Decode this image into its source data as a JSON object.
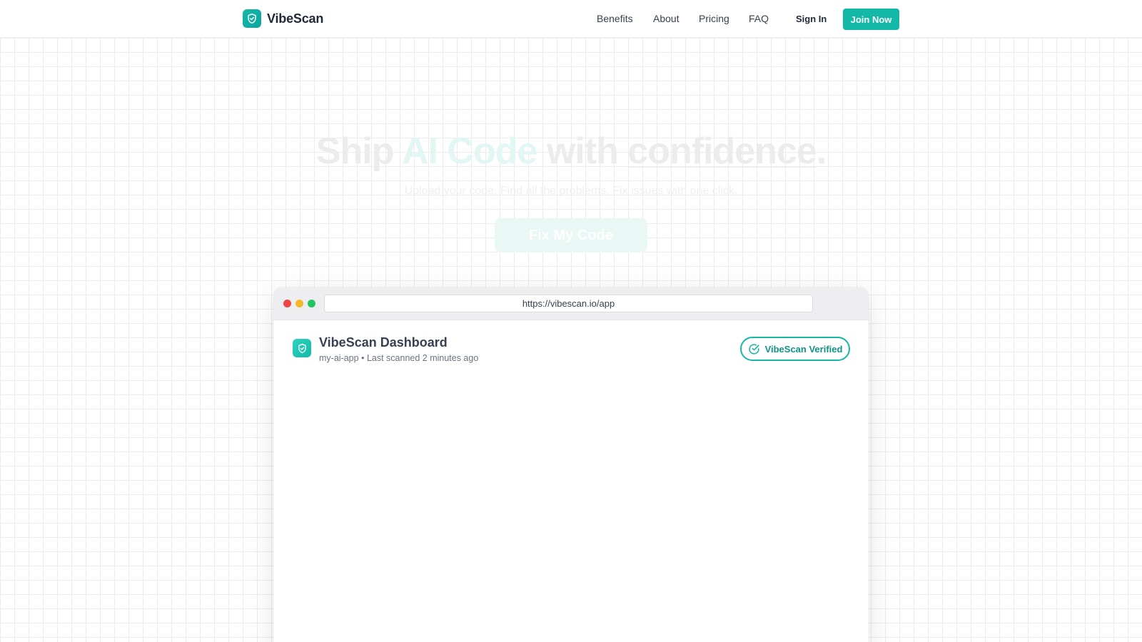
{
  "brand": {
    "name": "VibeScan",
    "logo_icon": "shield-check-icon",
    "accent": "#14b8a6"
  },
  "nav": {
    "links": [
      "Benefits",
      "About",
      "Pricing",
      "FAQ"
    ],
    "sign_in": "Sign In",
    "join": "Join Now"
  },
  "hero": {
    "title_part1": "Ship ",
    "title_accent": "AI Code",
    "title_part2": " with ",
    "title_underline": "confidence",
    "title_end": ".",
    "subtitle": "Upload your code. Find all the problems. Fix issues with one click.",
    "cta": "Fix My Code"
  },
  "browser": {
    "url": "https://vibescan.io/app",
    "dashboard_title": "VibeScan Dashboard",
    "project": "my-ai-app",
    "separator": "•",
    "last_scanned": "Last scanned 2 minutes ago",
    "badge": "VibeScan Verified",
    "badge_icon": "check-circle-icon"
  }
}
